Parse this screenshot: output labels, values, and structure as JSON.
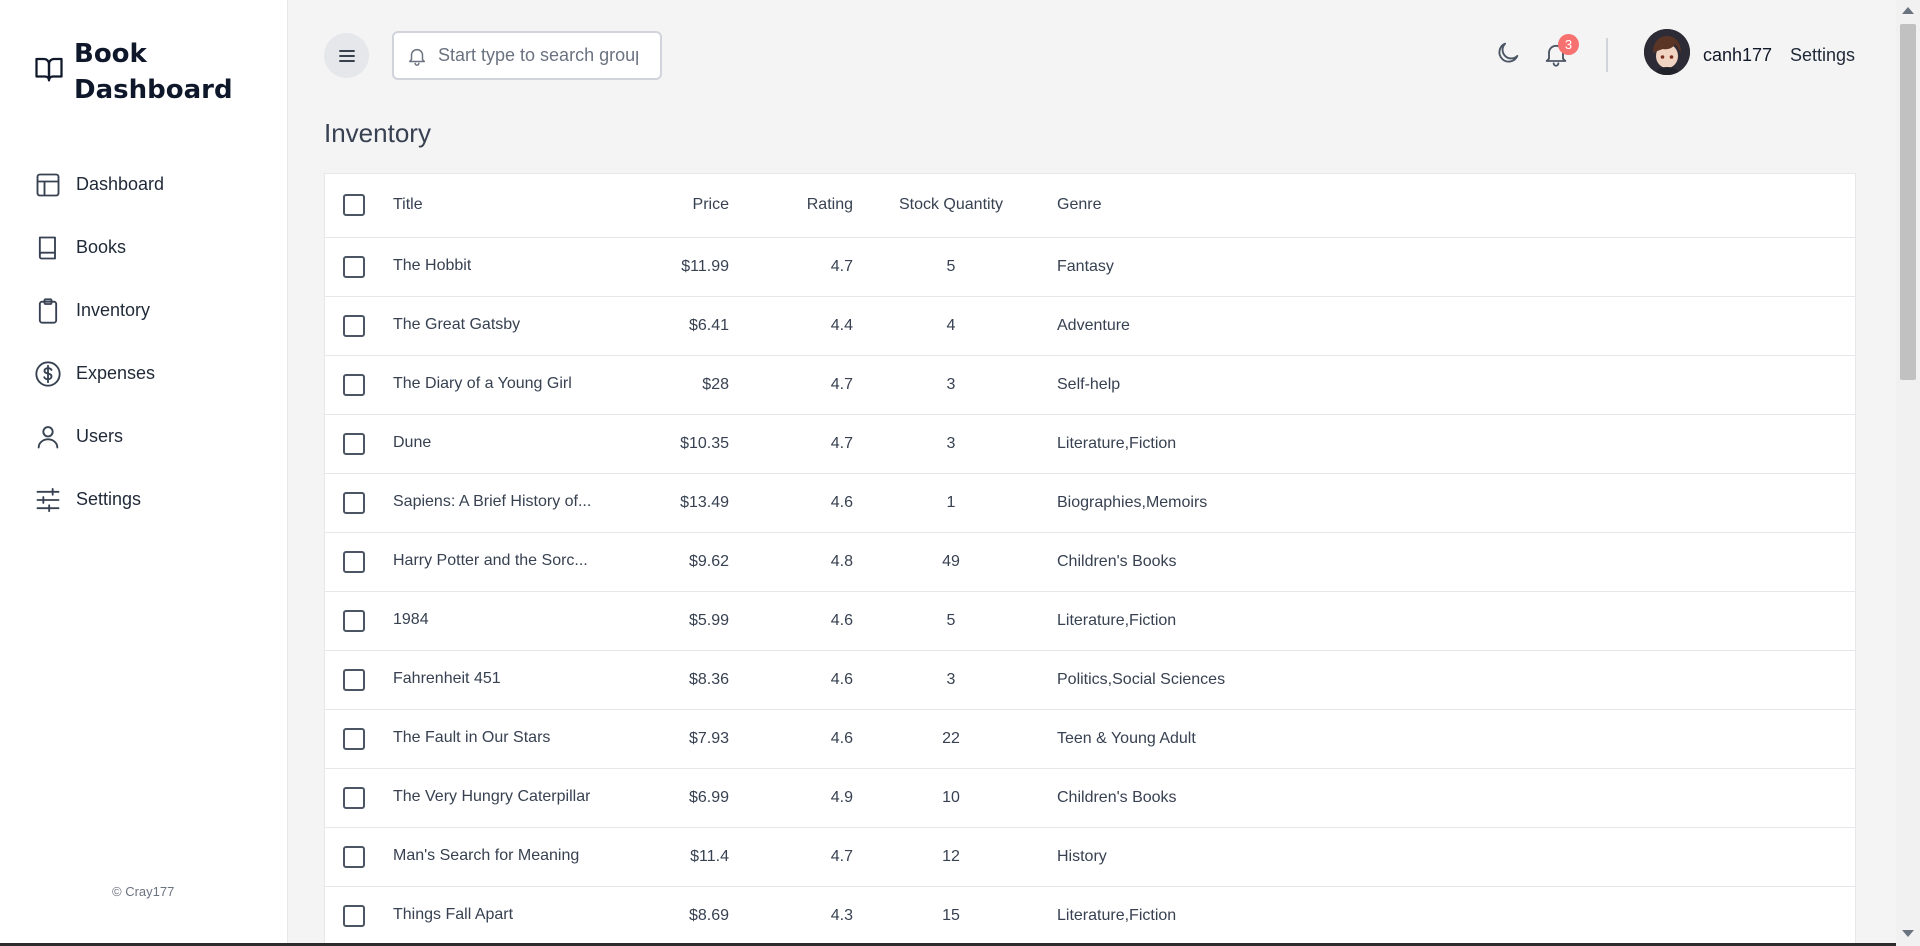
{
  "brand": {
    "title": "Book Dashboard"
  },
  "sidebar": {
    "items": [
      {
        "label": "Dashboard",
        "icon": "layout-icon"
      },
      {
        "label": "Books",
        "icon": "book-icon"
      },
      {
        "label": "Inventory",
        "icon": "clipboard-icon"
      },
      {
        "label": "Expenses",
        "icon": "dollar-circle-icon"
      },
      {
        "label": "Users",
        "icon": "user-icon"
      },
      {
        "label": "Settings",
        "icon": "sliders-icon"
      }
    ],
    "footer": "© Cray177"
  },
  "header": {
    "search_placeholder": "Start type to search groups",
    "notification_count": "3",
    "username": "canh177",
    "settings_label": "Settings"
  },
  "page": {
    "title": "Inventory"
  },
  "table": {
    "columns": [
      "Title",
      "Price",
      "Rating",
      "Stock Quantity",
      "Genre"
    ],
    "rows": [
      {
        "title": "The Hobbit",
        "price": "$11.99",
        "rating": "4.7",
        "stock": "5",
        "genre": "Fantasy"
      },
      {
        "title": "The Great Gatsby",
        "price": "$6.41",
        "rating": "4.4",
        "stock": "4",
        "genre": "Adventure"
      },
      {
        "title": "The Diary of a Young Girl",
        "price": "$28",
        "rating": "4.7",
        "stock": "3",
        "genre": "Self-help"
      },
      {
        "title": "Dune",
        "price": "$10.35",
        "rating": "4.7",
        "stock": "3",
        "genre": "Literature,Fiction"
      },
      {
        "title": "Sapiens: A Brief History of...",
        "price": "$13.49",
        "rating": "4.6",
        "stock": "1",
        "genre": "Biographies,Memoirs"
      },
      {
        "title": "Harry Potter and the Sorc...",
        "price": "$9.62",
        "rating": "4.8",
        "stock": "49",
        "genre": "Children's Books"
      },
      {
        "title": "1984",
        "price": "$5.99",
        "rating": "4.6",
        "stock": "5",
        "genre": "Literature,Fiction"
      },
      {
        "title": "Fahrenheit 451",
        "price": "$8.36",
        "rating": "4.6",
        "stock": "3",
        "genre": "Politics,Social Sciences"
      },
      {
        "title": "The Fault in Our Stars",
        "price": "$7.93",
        "rating": "4.6",
        "stock": "22",
        "genre": "Teen & Young Adult"
      },
      {
        "title": "The Very Hungry Caterpillar",
        "price": "$6.99",
        "rating": "4.9",
        "stock": "10",
        "genre": "Children's Books"
      },
      {
        "title": "Man's Search for Meaning",
        "price": "$11.4",
        "rating": "4.7",
        "stock": "12",
        "genre": "History"
      },
      {
        "title": "Things Fall Apart",
        "price": "$8.69",
        "rating": "4.3",
        "stock": "15",
        "genre": "Literature,Fiction"
      }
    ]
  }
}
